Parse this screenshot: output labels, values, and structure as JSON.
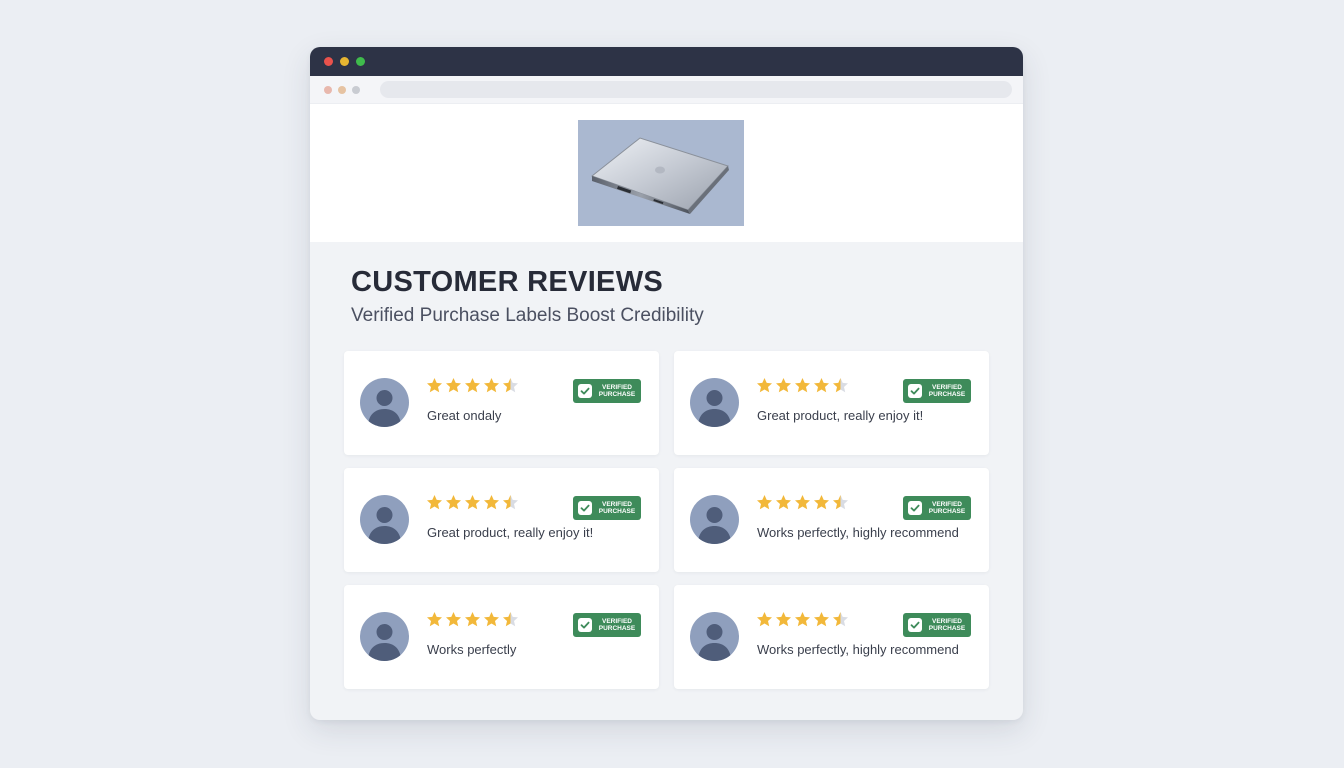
{
  "window": {
    "product_image": {
      "alt": "Laptop product image"
    }
  },
  "page": {
    "title": "CUSTOMER REVIEWS",
    "subtitle": "Verified Purchase Labels Boost Credibility"
  },
  "reviews": [
    {
      "text": "Great ondaly",
      "rating": 4.5,
      "badge_line1": "VERIFIED",
      "badge_line2": "PURCHASE"
    },
    {
      "text": "Great product, really enjoy it!",
      "rating": 4.5,
      "badge_line1": "VERIFIED",
      "badge_line2": "PURCHASE"
    },
    {
      "text": "Great product, really enjoy it!",
      "rating": 4.5,
      "badge_line1": "VERIFIED",
      "badge_line2": "PURCHASE"
    },
    {
      "text": "Works perfectly, highly recommend",
      "rating": 4.5,
      "badge_line1": "VERIFIED",
      "badge_line2": "PURCHASE"
    },
    {
      "text": "Works perfectly",
      "rating": 4.5,
      "badge_line1": "VERIFIED",
      "badge_line2": "PURCHASE"
    },
    {
      "text": "Works perfectly, highly recommend",
      "rating": 4.5,
      "badge_line1": "VERIFIED",
      "badge_line2": "PURCHASE"
    }
  ],
  "colors": {
    "titlebar": "#2d3346",
    "star": "#f2b83a",
    "star_empty": "#d9dce3",
    "badge": "#3e8b5a",
    "avatar": "#8f9fbd"
  },
  "icons": {
    "star": "star-icon",
    "badge": "check-icon",
    "avatar": "user-avatar-icon"
  }
}
